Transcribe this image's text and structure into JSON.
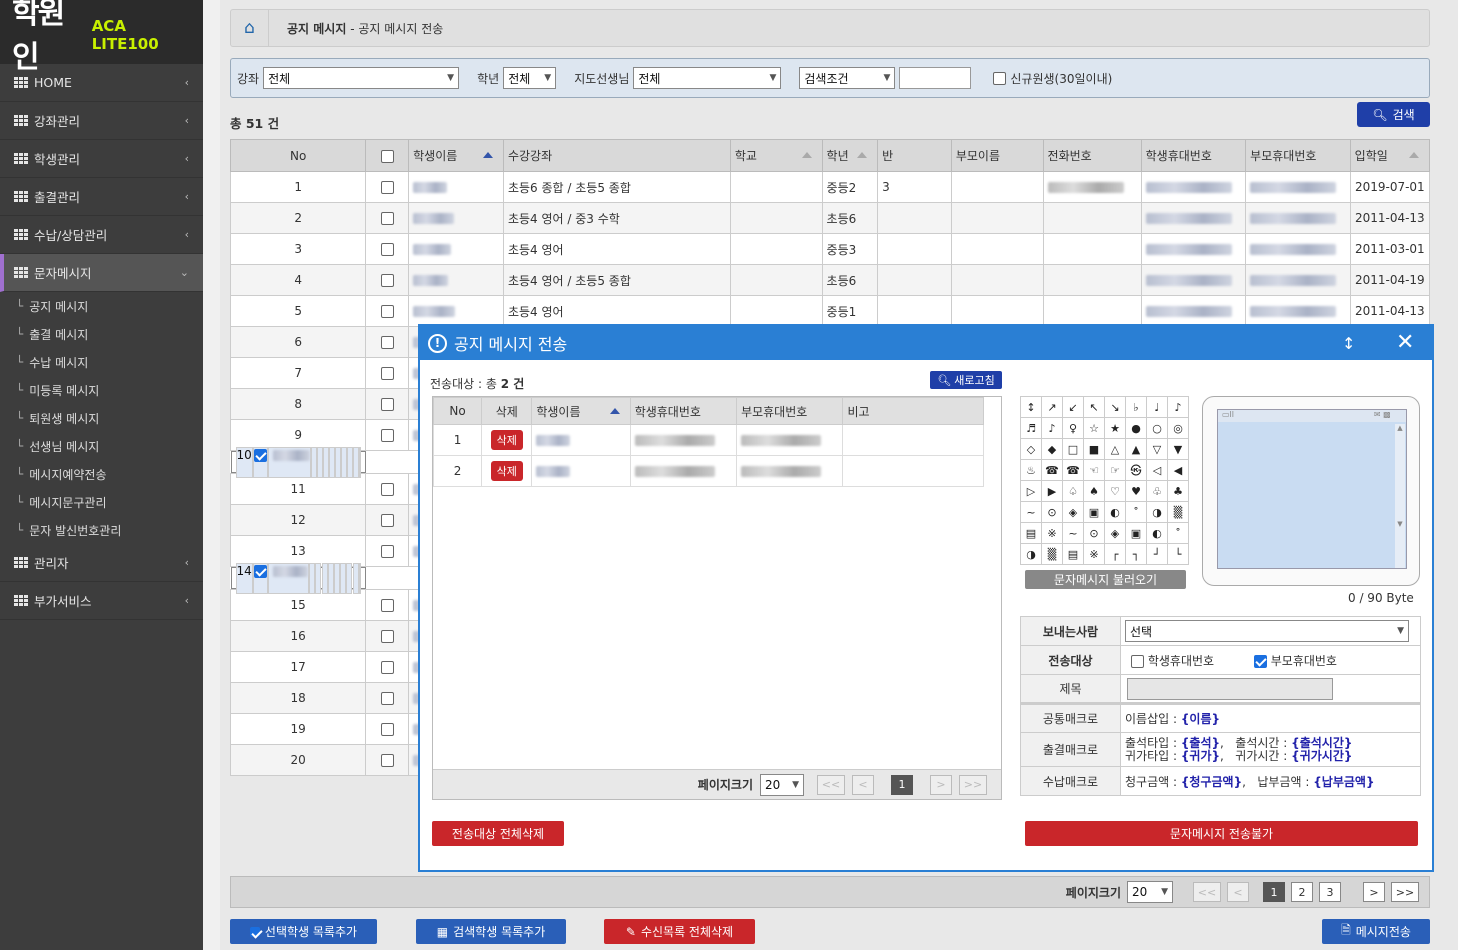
{
  "app": {
    "logo_main": "학원인",
    "logo_sub": "ACA LITE100"
  },
  "sidebar": {
    "items": [
      {
        "label": "HOME"
      },
      {
        "label": "강좌관리"
      },
      {
        "label": "학생관리"
      },
      {
        "label": "출결관리"
      },
      {
        "label": "수납/상담관리"
      },
      {
        "label": "문자메시지"
      }
    ],
    "submenu": [
      {
        "label": "공지 메시지"
      },
      {
        "label": "출결 메시지"
      },
      {
        "label": "수납 메시지"
      },
      {
        "label": "미등록 메시지"
      },
      {
        "label": "퇴원생 메시지"
      },
      {
        "label": "선생님 메시지"
      },
      {
        "label": "메시지예약전송"
      },
      {
        "label": "메시지문구관리"
      },
      {
        "label": "문자 발신번호관리"
      }
    ],
    "bottom_items": [
      {
        "label": "관리자"
      },
      {
        "label": "부가서비스"
      }
    ]
  },
  "breadcrumb": {
    "section": "공지 메시지",
    "separator": " - ",
    "page": "공지 메시지 전송"
  },
  "filter": {
    "course_label": "강좌",
    "course_value": "전체",
    "grade_label": "학년",
    "grade_value": "전체",
    "teacher_label": "지도선생님",
    "teacher_value": "전체",
    "search_cond": "검색조건",
    "new_student_label": "신규원생(30일이내)"
  },
  "total": "총 51 건",
  "search_button": "검색",
  "table": {
    "headers": [
      "No",
      "",
      "학생이름",
      "수강강좌",
      "학교",
      "학년",
      "반",
      "부모이름",
      "전화번호",
      "학생휴대번호",
      "부모휴대번호",
      "입학일"
    ],
    "rows": [
      {
        "no": "1",
        "course": "초등6 종합 / 초등5 종합",
        "grade": "중등2",
        "ban": "3",
        "date": "2019-07-01"
      },
      {
        "no": "2",
        "course": "초등4 영어 / 중3 수학",
        "grade": "초등6",
        "ban": "",
        "date": "2011-04-13"
      },
      {
        "no": "3",
        "course": "초등4 영어",
        "grade": "중등3",
        "ban": "",
        "date": "2011-03-01"
      },
      {
        "no": "4",
        "course": "초등4 영어 / 초등5 종합",
        "grade": "초등6",
        "ban": "",
        "date": "2011-04-19"
      },
      {
        "no": "5",
        "course": "초등4 영어",
        "grade": "중등1",
        "ban": "",
        "date": "2011-04-13"
      },
      {
        "no": "6"
      },
      {
        "no": "7"
      },
      {
        "no": "8"
      },
      {
        "no": "9"
      },
      {
        "no": "10",
        "checked": true
      },
      {
        "no": "11"
      },
      {
        "no": "12"
      },
      {
        "no": "13"
      },
      {
        "no": "14",
        "checked": true
      },
      {
        "no": "15"
      },
      {
        "no": "16"
      },
      {
        "no": "17"
      },
      {
        "no": "18"
      },
      {
        "no": "19"
      },
      {
        "no": "20"
      }
    ]
  },
  "pager": {
    "size_label": "페이지크기",
    "size_value": "20",
    "pages": [
      "1",
      "2",
      "3"
    ],
    "current": "1",
    "prev_all": "<<",
    "prev": "<",
    "next": ">",
    "next_all": ">>"
  },
  "actions": {
    "add_selected": "선택학생 목록추가",
    "add_searched": "검색학생 목록추가",
    "clear_recipients": "수신목록 전체삭제",
    "send_message": "메시지전송"
  },
  "modal": {
    "title": "공지 메시지 전송",
    "count_label": "전송대상 : 총",
    "count_value": "2 건",
    "refresh": "새로고침",
    "headers": [
      "No",
      "삭제",
      "학생이름",
      "학생휴대번호",
      "부모휴대번호",
      "비고"
    ],
    "rows": [
      {
        "no": "1",
        "del": "삭제"
      },
      {
        "no": "2",
        "del": "삭제"
      }
    ],
    "pager": {
      "size_label": "페이지크기",
      "size_value": "20",
      "current": "1",
      "prev_all": "<<",
      "prev": "<",
      "next": ">",
      "next_all": ">>"
    },
    "clear_all": "전송대상 전체삭제",
    "symbols": [
      [
        "↕",
        "↗",
        "↙",
        "↖",
        "↘",
        "♭",
        "♩",
        "♪"
      ],
      [
        "♬",
        "♪",
        "♀",
        "☆",
        "★",
        "●",
        "○",
        "◎"
      ],
      [
        "◇",
        "◆",
        "□",
        "■",
        "△",
        "▲",
        "▽",
        "▼"
      ],
      [
        "♨",
        "☎",
        "☎",
        "☜",
        "☞",
        "㉿",
        "◁",
        "◀"
      ],
      [
        "▷",
        "▶",
        "♤",
        "♠",
        "♡",
        "♥",
        "♧",
        "♣"
      ],
      [
        "~",
        "⊙",
        "◈",
        "▣",
        "◐",
        "˚",
        "◑",
        "▒"
      ],
      [
        "▤",
        "※",
        "~",
        "⊙",
        "◈",
        "▣",
        "◐",
        "˚"
      ],
      [
        "◑",
        "▒",
        "▤",
        "※",
        "┌",
        "┐",
        "┘",
        "└"
      ]
    ],
    "load_button": "문자메시지 불러오기",
    "bytes": "0 / 90 Byte",
    "sender_label": "보내는사람",
    "sender_value": "선택",
    "target_label": "전송대상",
    "target_student": "학생휴대번호",
    "target_parent": "부모휴대번호",
    "subject_label": "제목",
    "macro_common_label": "공통매크로",
    "macro_common_text": "이름삽입 :",
    "macro_common_value": "{이름}",
    "macro_attend_label": "출결매크로",
    "macro_attend_l1a": "출석타입 :",
    "macro_attend_v1a": "{출석}",
    "macro_attend_l1b": "출석시간 :",
    "macro_attend_v1b": "{출석시간}",
    "macro_attend_l2a": "귀가타입 :",
    "macro_attend_v2a": "{귀가}",
    "macro_attend_l2b": "귀가시간 :",
    "macro_attend_v2b": "{귀가시간}",
    "macro_pay_label": "수납매크로",
    "macro_pay_la": "청구금액 :",
    "macro_pay_va": "{청구금액}",
    "macro_pay_lb": "납부금액 :",
    "macro_pay_vb": "{납부금액}",
    "send_disabled": "문자메시지 전송불가"
  }
}
